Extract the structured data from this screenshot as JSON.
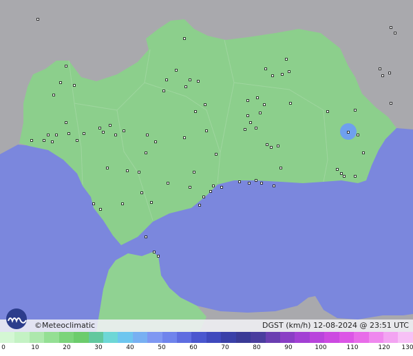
{
  "footer": {
    "brand": "©Meteoclimatic",
    "caption": "DGST (km/h)   12-08-2024 @ 23:51 UTC"
  },
  "legend": {
    "ticks": [
      "0",
      "10",
      "20",
      "30",
      "40",
      "50",
      "60",
      "70",
      "80",
      "90",
      "100",
      "110",
      "120",
      "130"
    ],
    "colors": [
      "#d4f7d4",
      "#c4f2c4",
      "#ade8ad",
      "#94df94",
      "#7bd47b",
      "#6ccc6c",
      "#62c89e",
      "#6ed7d6",
      "#6ec6ef",
      "#78b0f2",
      "#7f98f2",
      "#6f84ec",
      "#5e6de0",
      "#4a57cf",
      "#3f49bd",
      "#3a40a8",
      "#3a3a96",
      "#4a3d9e",
      "#6a3eb1",
      "#8a3ec5",
      "#a240d4",
      "#b944dc",
      "#cc4ae1",
      "#dc56e6",
      "#e86ce9",
      "#ef88ee",
      "#f3a4f2",
      "#f7c0f6"
    ]
  },
  "map": {
    "colors": {
      "sea": "#7b87dd",
      "land_outside": "#a9a9ad",
      "andalusia": "#8ccf8c",
      "morocco": "#90d292",
      "gust_hotspot": "#6fa0ee",
      "station": "#111111"
    }
  }
}
